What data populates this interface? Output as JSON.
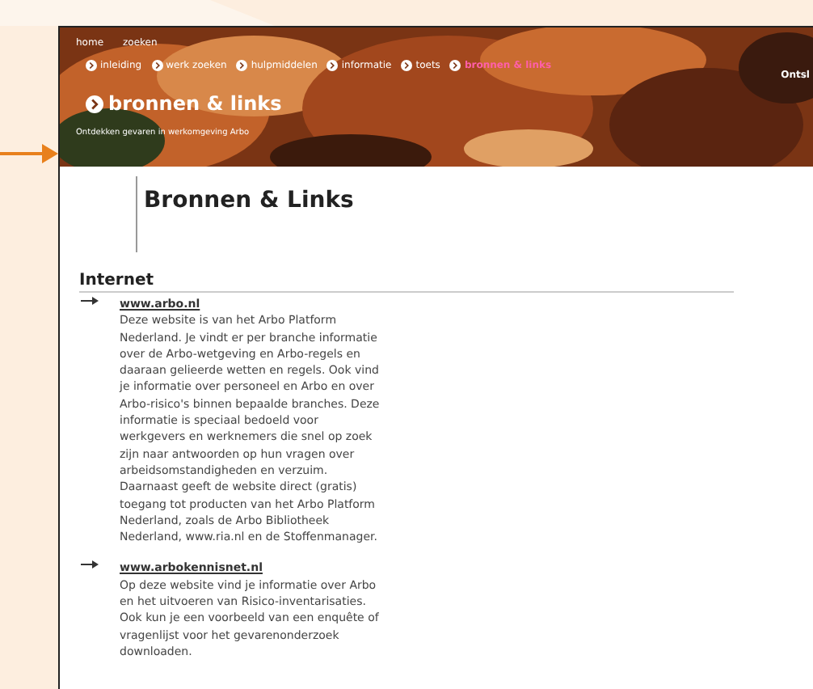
{
  "top_links": [
    "home",
    "zoeken"
  ],
  "nav": [
    {
      "label": "inleiding",
      "selected": false
    },
    {
      "label": "werk zoeken",
      "selected": false
    },
    {
      "label": "hulpmiddelen",
      "selected": false
    },
    {
      "label": "informatie",
      "selected": false
    },
    {
      "label": "toets",
      "selected": false
    },
    {
      "label": "bronnen & links",
      "selected": true
    }
  ],
  "corner_label": "Ontsl",
  "header": {
    "title": "bronnen & links",
    "subtitle": "Ontdekken gevaren in werkomgeving Arbo"
  },
  "page_title": "Bronnen & Links",
  "section": {
    "title": "Internet",
    "links": [
      {
        "url": "www.arbo.nl",
        "text": "Deze website is van het Arbo Platform Nederland. Je vindt er per branche informatie over de Arbo-wetgeving en Arbo-regels en daaraan gelieerde wetten en regels. Ook vind je informatie over personeel en Arbo en over Arbo-risico's binnen bepaalde branches. Deze informatie is speciaal bedoeld voor werkgevers en werknemers die snel op zoek zijn naar antwoorden op hun vragen over arbeidsomstandigheden en verzuim. Daarnaast geeft de website direct (gratis) toegang tot producten van het Arbo Platform Nederland, zoals de Arbo Bibliotheek Nederland, www.ria.nl en de Stoffenmanager."
      },
      {
        "url": "www.arbokennisnet.nl",
        "text": "Op deze website vind je informatie over Arbo en het uitvoeren van Risico-inventarisaties. Ook kun je een voorbeeld van een enquête of vragenlijst voor het gevarenonderzoek downloaden."
      }
    ]
  }
}
